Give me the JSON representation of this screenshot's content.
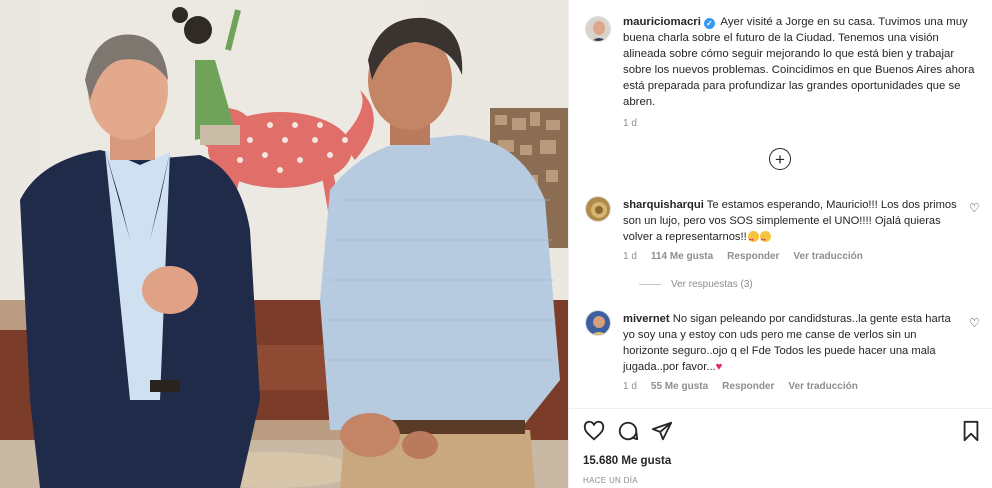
{
  "post": {
    "author": "mauriciomacri",
    "caption": "Ayer visité a Jorge en su casa. Tuvimos una muy buena charla sobre el futuro de la Ciudad. Tenemos una visión alineada sobre cómo seguir mejorando lo que está bien y trabajar sobre los nuevos problemas. Coincidimos en que Buenos Aires ahora está preparada para profundizar las grandes oportunidades que se abren.",
    "caption_age": "1 d",
    "likes": "15.680 Me gusta",
    "posted_ago": "HACE UN DÍA"
  },
  "comments": [
    {
      "user": "sharquisharqui",
      "text": "Te estamos esperando, Mauricio!!! Los dos primos son un lujo, pero vos SOS simplemente el UNO!!!! Ojalá quieras volver a representarnos!!",
      "age": "1 d",
      "likes": "114 Me gusta",
      "reply": "Responder",
      "translate": "Ver traducción",
      "replies_label": "Ver respuestas (3)"
    },
    {
      "user": "mivernet",
      "text": "No sigan peleando por candidsturas..la gente esta harta yo soy una y estoy con uds pero me canse de verlos sin un horizonte seguro..ojo q el Fde Todos les puede hacer una mala jugada..por favor...",
      "age": "1 d",
      "likes": "55 Me gusta",
      "reply": "Responder",
      "translate": "Ver traducción"
    }
  ],
  "icons": {
    "verified": "verified-badge-icon",
    "add": "plus-circle-icon",
    "like": "heart-icon",
    "comment": "comment-bubble-icon",
    "share": "paper-plane-icon",
    "save": "bookmark-icon"
  },
  "colors": {
    "verified": "#3897f0",
    "secondary_text": "#8e8e8e",
    "heart_red": "#e0245e"
  }
}
